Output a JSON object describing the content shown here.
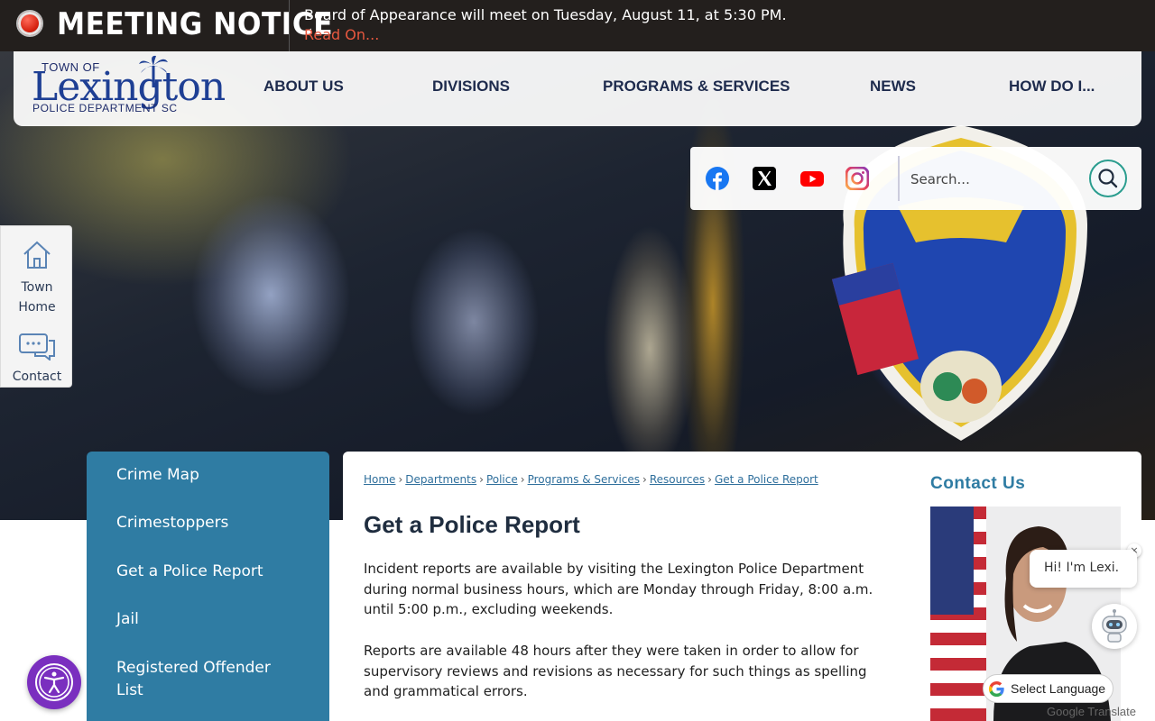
{
  "alert": {
    "title": "MEETING NOTICE",
    "message": "Board of Appearance will meet on Tuesday, August 11, at 5:30 PM.",
    "link": "Read On..."
  },
  "logo": {
    "line1": "TOWN OF",
    "line2": "Lexington",
    "line3": "POLICE DEPARTMENT  SC"
  },
  "nav": {
    "items": [
      "ABOUT US",
      "DIVISIONS",
      "PROGRAMS & SERVICES",
      "NEWS",
      "HOW DO I..."
    ]
  },
  "search": {
    "placeholder": "Search..."
  },
  "social": [
    "facebook-icon",
    "x-icon",
    "youtube-icon",
    "instagram-icon"
  ],
  "quick_links": [
    {
      "label_line1": "Town",
      "label_line2": "Home",
      "icon": "home-icon"
    },
    {
      "label_line1": "Contact",
      "icon": "chat-icon"
    }
  ],
  "sidebar": {
    "items": [
      "Crime Map",
      "Crimestoppers",
      "Get a Police Report",
      "Jail",
      "Registered Offender List"
    ]
  },
  "breadcrumb": [
    "Home",
    "Departments",
    "Police",
    "Programs & Services",
    "Resources",
    "Get a Police Report"
  ],
  "page": {
    "title": "Get a Police Report",
    "paragraph1": "Incident reports are available by visiting the Lexington Police Department during normal business hours, which are Monday through Friday, 8:00 a.m. until 5:00 p.m., excluding weekends.",
    "paragraph2": "Reports are available 48 hours after they were taken in order to allow for supervisory reviews and revisions as necessary for such things as spelling and grammatical errors."
  },
  "contact": {
    "title": "Contact Us"
  },
  "chat": {
    "greeting": "Hi! I'm Lexi.",
    "close": "×"
  },
  "translate": {
    "label": "Select Language",
    "powered_by": "Google Translate"
  },
  "colors": {
    "alert_bg": "#231f1d",
    "alert_link": "#e8583f",
    "nav_text": "#1e2b4d",
    "sidebar_bg": "#2f7ca3",
    "contact_title": "#2f7ca3",
    "accessibility": "#7a2fbf"
  }
}
